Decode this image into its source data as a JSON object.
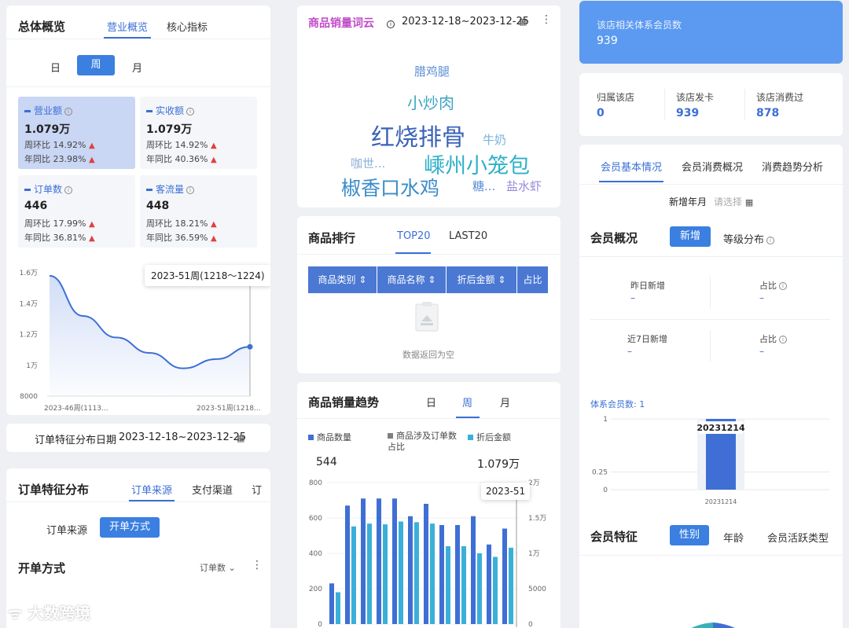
{
  "overview": {
    "title": "总体概览",
    "tabs": [
      "营业概览",
      "核心指标"
    ],
    "periods": [
      "日",
      "周",
      "月"
    ],
    "stats": [
      {
        "label": "营业额",
        "value": "1.079万",
        "r1": "周环比 14.92%",
        "r2": "年同比 23.98%"
      },
      {
        "label": "实收额",
        "value": "1.079万",
        "r1": "周环比 14.92%",
        "r2": "年同比 40.36%"
      },
      {
        "label": "订单数",
        "value": "446",
        "r1": "周环比 17.99%",
        "r2": "年同比 36.81%"
      },
      {
        "label": "客流量",
        "value": "448",
        "r1": "周环比 18.21%",
        "r2": "年同比 36.59%"
      }
    ],
    "tooltip": "2023-51周(1218～1224)"
  },
  "date_bar": {
    "label": "订单特征分布日期",
    "value": "2023-12-18~2023-12-25"
  },
  "order_feature": {
    "title": "订单特征分布",
    "tabs": [
      "订单来源",
      "支付渠道",
      "订"
    ],
    "sub_tabs": [
      "订单来源",
      "开单方式"
    ],
    "section": "开单方式",
    "dropdown": "订单数"
  },
  "wordcloud": {
    "title": "商品销量词云",
    "date": "2023-12-18~2023-12-25",
    "words": [
      {
        "text": "腊鸡腿",
        "color": "#5b8fd6"
      },
      {
        "text": "小炒肉",
        "color": "#3aa6c0"
      },
      {
        "text": "红烧排骨",
        "color": "#3a62b8"
      },
      {
        "text": "牛奶",
        "color": "#7ab3d8"
      },
      {
        "text": "咖世...",
        "color": "#8ab0d8"
      },
      {
        "text": "嵊州小笼包",
        "color": "#2fb0c8"
      },
      {
        "text": "椒香口水鸡",
        "color": "#3b8cc8"
      },
      {
        "text": "糖...",
        "color": "#5a8ed8"
      },
      {
        "text": "盐水虾",
        "color": "#9a8ad8"
      }
    ]
  },
  "ranking": {
    "title": "商品排行",
    "tabs": [
      "TOP20",
      "LAST20"
    ],
    "columns": [
      "商品类别",
      "商品名称",
      "折后金额",
      "占比"
    ],
    "empty": "数据返回为空"
  },
  "trend": {
    "title": "商品销量趋势",
    "periods": [
      "日",
      "周",
      "月"
    ],
    "legend": [
      {
        "name": "商品数量",
        "color": "#3f6fd4"
      },
      {
        "name": "商品涉及订单数占比",
        "color": "#7f7f7f"
      },
      {
        "name": "折后金额",
        "color": "#3ab0d8"
      }
    ],
    "qty_total": "544",
    "amount_total": "1.079万",
    "tooltip": "2023-51"
  },
  "member": {
    "banner_label": "该店相关体系会员数",
    "banner_value": "939",
    "stats": [
      {
        "label": "归属该店",
        "value": "0"
      },
      {
        "label": "该店发卡",
        "value": "939"
      },
      {
        "label": "该店消费过",
        "value": "878"
      }
    ],
    "tabs": [
      "会员基本情况",
      "会员消费概况",
      "消费趋势分析"
    ],
    "new_month_label": "新增年月",
    "new_month_placeholder": "请选择",
    "overview_title": "会员概况",
    "overview_tabs": [
      "新增",
      "等级分布"
    ],
    "cells": [
      {
        "label": "昨日新增",
        "value": "–"
      },
      {
        "label": "占比",
        "value": "–"
      },
      {
        "label": "近7日新增",
        "value": "–"
      },
      {
        "label": "占比",
        "value": "–"
      }
    ],
    "system_count": "体系会员数: 1",
    "feature_title": "会员特征",
    "feature_tabs": [
      "性别",
      "年龄",
      "会员活跃类型"
    ]
  },
  "watermark": "大数跨境",
  "chart_data": [
    {
      "type": "line",
      "x": [
        "2023-46周(1113...",
        "2023-51周(1218..."
      ],
      "series": [
        {
          "values": [
            15800,
            13200,
            11800,
            10800,
            9800,
            10400,
            11200
          ]
        }
      ],
      "yticks": [
        "1.6万",
        "1.4万",
        "1.2万",
        "1万",
        "8000"
      ],
      "ylim": [
        8000,
        16000
      ]
    },
    {
      "type": "bar",
      "series": [
        {
          "name": "商品数量",
          "values": [
            230,
            670,
            710,
            710,
            710,
            610,
            680,
            560,
            560,
            610,
            450,
            540
          ]
        },
        {
          "name": "折后金额",
          "values": [
            4500,
            13800,
            14200,
            14100,
            14500,
            14400,
            14200,
            11000,
            11000,
            10000,
            9500,
            10800
          ]
        }
      ],
      "yticks_left": [
        "800",
        "600",
        "400",
        "200",
        "0"
      ],
      "yticks_right": [
        "2万",
        "1.5万",
        "1万",
        "5000",
        "0"
      ],
      "ylim": [
        0,
        800
      ]
    },
    {
      "type": "bar",
      "categories": [
        "20231214"
      ],
      "values": [
        1
      ],
      "yticks": [
        "1",
        "0.75",
        "0.5",
        "0.25",
        "0"
      ],
      "ylim": [
        0,
        1
      ],
      "label": "20231214"
    }
  ]
}
